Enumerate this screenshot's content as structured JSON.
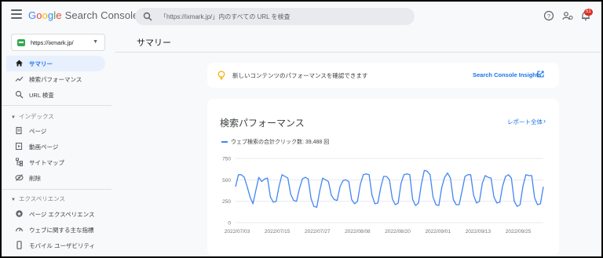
{
  "header": {
    "logo_google": [
      "G",
      "o",
      "o",
      "g",
      "l",
      "e"
    ],
    "product": "Search Console",
    "search_placeholder": "「https://ixmark.jp/」内のすべての URL を検査",
    "notification_count": "51"
  },
  "sidebar": {
    "property": "https://ixmark.jp/",
    "items_top": [
      {
        "label": "サマリー",
        "icon": "home-icon",
        "active": true
      },
      {
        "label": "検索パフォーマンス",
        "icon": "trending-icon"
      },
      {
        "label": "URL 検査",
        "icon": "search-icon"
      }
    ],
    "index_section": "インデックス",
    "index_items": [
      {
        "label": "ページ",
        "icon": "pages-icon"
      },
      {
        "label": "動画ページ",
        "icon": "video-pages-icon"
      },
      {
        "label": "サイトマップ",
        "icon": "sitemap-icon"
      },
      {
        "label": "削除",
        "icon": "removal-icon"
      }
    ],
    "experience_section": "エクスペリエンス",
    "experience_items": [
      {
        "label": "ページ エクスペリエンス",
        "icon": "page-experience-icon"
      },
      {
        "label": "ウェブに関する主な指標",
        "icon": "web-vitals-icon"
      },
      {
        "label": "モバイル ユーザビリティ",
        "icon": "mobile-icon"
      }
    ]
  },
  "main": {
    "page_title": "サマリー",
    "insights_text": "新しいコンテンツのパフォーマンスを確認できます",
    "insights_link": "Search Console Insights",
    "perf_title": "検索パフォーマンス",
    "report_link": "レポート全体",
    "legend": "ウェブ検索の合計クリック数: 39,488 回"
  },
  "colors": {
    "accent": "#1a73e8",
    "line": "#4285f4",
    "active_nav_bg": "#e8f0fe"
  },
  "chart_data": {
    "type": "line",
    "yticks": [
      "750",
      "500",
      "250",
      "0"
    ],
    "ylim": [
      0,
      750
    ],
    "xticks": [
      "2022/07/03",
      "2022/07/15",
      "2022/07/27",
      "2022/08/08",
      "2022/08/20",
      "2022/09/01",
      "2022/09/13",
      "2022/09/25"
    ],
    "series": [
      {
        "name": "ウェブ検索の合計クリック数",
        "values": [
          420,
          560,
          560,
          530,
          420,
          300,
          220,
          380,
          530,
          480,
          510,
          520,
          300,
          240,
          250,
          430,
          560,
          540,
          520,
          330,
          260,
          250,
          400,
          510,
          530,
          510,
          280,
          190,
          180,
          370,
          520,
          500,
          480,
          320,
          270,
          260,
          420,
          490,
          500,
          480,
          270,
          220,
          250,
          450,
          560,
          570,
          560,
          320,
          220,
          230,
          410,
          540,
          540,
          500,
          280,
          210,
          230,
          460,
          560,
          570,
          560,
          270,
          200,
          230,
          450,
          610,
          600,
          560,
          300,
          210,
          200,
          410,
          530,
          580,
          520,
          270,
          210,
          210,
          370,
          540,
          560,
          560,
          320,
          230,
          250,
          460,
          550,
          530,
          520,
          300,
          230,
          240,
          430,
          540,
          560,
          520,
          250,
          190,
          210,
          430,
          560,
          550,
          550,
          290,
          210,
          220,
          420
        ]
      }
    ]
  }
}
